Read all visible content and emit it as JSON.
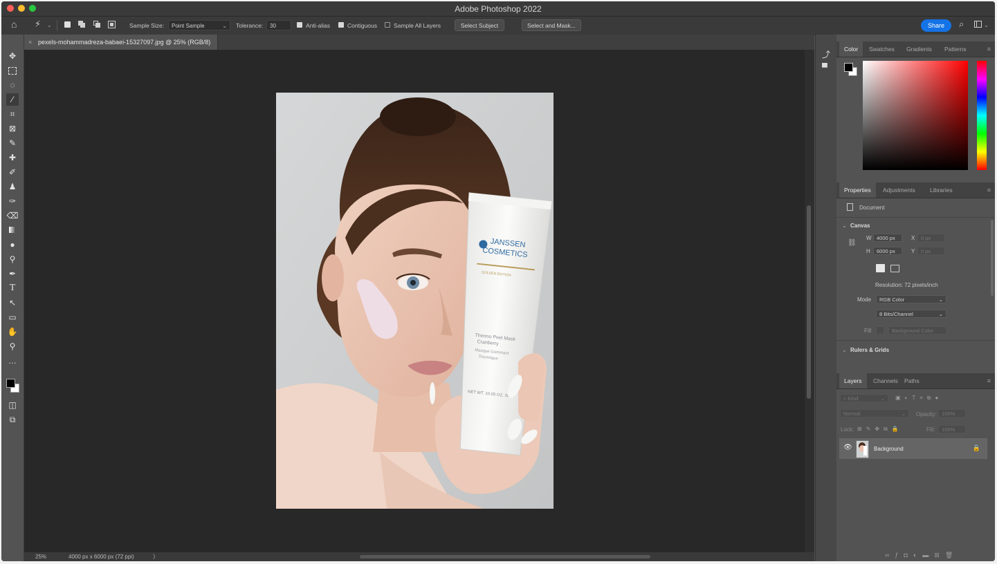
{
  "window": {
    "title": "Adobe Photoshop 2022"
  },
  "options_bar": {
    "sample_size_label": "Sample Size:",
    "sample_size_value": "Point Sample",
    "tolerance_label": "Tolerance:",
    "tolerance_value": "30",
    "anti_alias_label": "Anti-alias",
    "contiguous_label": "Contiguous",
    "sample_all_layers_label": "Sample All Layers",
    "select_subject_label": "Select Subject",
    "select_and_mask_label": "Select and Mask...",
    "share_label": "Share"
  },
  "document": {
    "tab_title": "pexels-mohammadreza-babaei-15327097.jpg @ 25% (RGB/8)",
    "close_glyph": "×"
  },
  "status": {
    "zoom": "25%",
    "dimensions": "4000 px x 6000 px (72 ppi)",
    "arrow": "〉"
  },
  "product": {
    "brand_line1": "JANSSEN",
    "brand_line2": "COSMETICS",
    "brand_sub": "GOLDEN EDITION",
    "name_line1": "Thermo Peel Mask",
    "name_line2": "Cranberry",
    "name_line3": "Masque Gommant",
    "name_line4": "Thermique",
    "net_wt": "NET WT. 10.05 OZ.  30"
  },
  "color_panel": {
    "tabs": [
      "Color",
      "Swatches",
      "Gradients",
      "Patterns"
    ]
  },
  "properties_panel": {
    "tabs": [
      "Properties",
      "Adjustments",
      "Libraries"
    ],
    "document_label": "Document",
    "canvas_section": "Canvas",
    "w_label": "W",
    "w_value": "4000 px",
    "h_label": "H",
    "h_value": "6000 px",
    "x_label": "X",
    "x_value": "0 px",
    "y_label": "Y",
    "y_value": "0 px",
    "resolution": "Resolution: 72 pixels/inch",
    "mode_label": "Mode",
    "mode_value": "RGB Color",
    "bits_value": "8 Bits/Channel",
    "fill_label": "Fill",
    "fill_value": "Background Color",
    "rulers_section": "Rulers & Grids"
  },
  "layers_panel": {
    "tabs": [
      "Layers",
      "Channels",
      "Paths"
    ],
    "kind_label": "Kind",
    "blend_mode": "Normal",
    "opacity_label": "Opacity:",
    "opacity_value": "100%",
    "lock_label": "Lock:",
    "fill_label": "Fill:",
    "fill_value": "100%",
    "layer_name": "Background"
  },
  "colors": {
    "accent": "#1473e6",
    "fg_color": "#000000",
    "bg_color": "#ffffff"
  }
}
